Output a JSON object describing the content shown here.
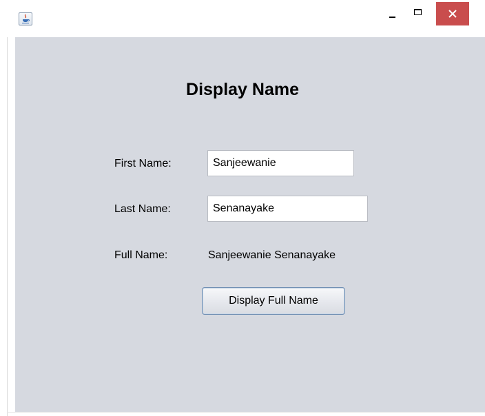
{
  "window": {
    "title": "",
    "icon": "java-cup-icon",
    "controls": {
      "minimize": "minimize-icon",
      "maximize": "maximize-icon",
      "close": "close-icon"
    }
  },
  "form": {
    "heading": "Display Name",
    "first_name_label": "First Name:",
    "first_name_value": "Sanjeewanie",
    "last_name_label": "Last Name:",
    "last_name_value": "Senanayake",
    "full_name_label": "Full Name:",
    "full_name_value": "Sanjeewanie Senanayake",
    "button_label": "Display Full Name"
  },
  "colors": {
    "content_background": "#d6d9e0",
    "close_button": "#c94d4d",
    "button_border": "#6f8fb4"
  }
}
